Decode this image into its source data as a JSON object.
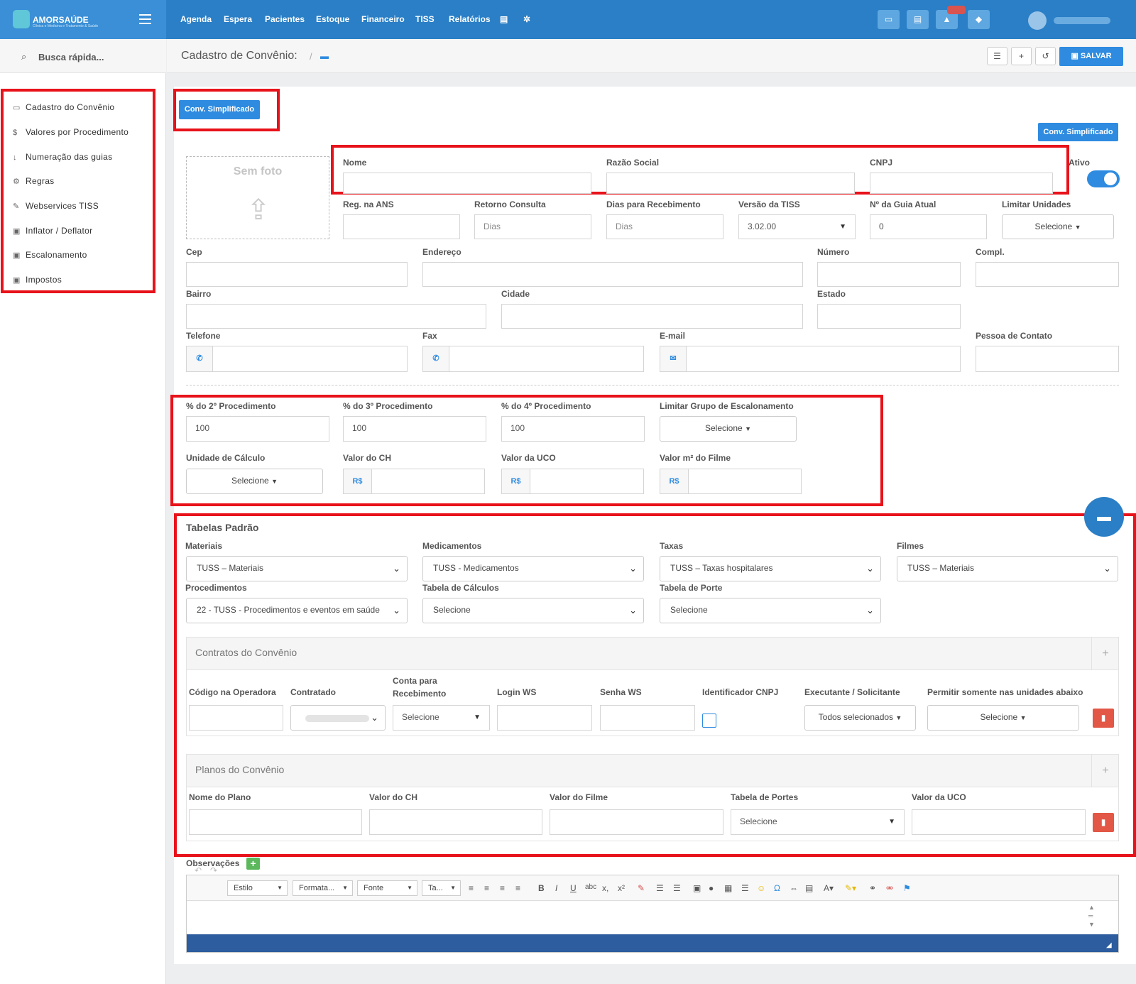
{
  "brand": {
    "name": "AMORSAÚDE",
    "tagline": "Clínica e Medicina e Tratamento & Saúde"
  },
  "nav": [
    "Agenda",
    "Espera",
    "Pacientes",
    "Estoque",
    "Financeiro",
    "TISS",
    "Relatórios"
  ],
  "search": {
    "label": "Busca rápida..."
  },
  "sidebar": [
    {
      "label": "Cadastro do Convênio",
      "icon": "card-icon"
    },
    {
      "label": "Valores por Procedimento",
      "icon": "dollar-icon"
    },
    {
      "label": "Numeração das guias",
      "icon": "sort-icon"
    },
    {
      "label": "Regras",
      "icon": "gears-icon"
    },
    {
      "label": "Webservices TISS",
      "icon": "plug-icon"
    },
    {
      "label": "Inflator / Deflator",
      "icon": "money-icon"
    },
    {
      "label": "Escalonamento",
      "icon": "money-icon"
    },
    {
      "label": "Impostos",
      "icon": "money-icon"
    }
  ],
  "header": {
    "title": "Cadastro de Convênio:",
    "sep": "/",
    "save": "SALVAR"
  },
  "conv_simplificado": "Conv. Simplificado",
  "photo": {
    "label": "Sem foto"
  },
  "fields": {
    "nome": "Nome",
    "razao": "Razão Social",
    "cnpj": "CNPJ",
    "ativo": "Ativo",
    "reg_ans": "Reg. na ANS",
    "retorno": "Retorno Consulta",
    "retorno_ph": "Dias",
    "dias_receb": "Dias para Recebimento",
    "dias_receb_ph": "Dias",
    "versao_tiss": "Versão da TISS",
    "versao_tiss_val": "3.02.00",
    "guia_atual": "Nº da Guia Atual",
    "guia_atual_val": "0",
    "limitar_unidades": "Limitar Unidades",
    "selecione": "Selecione",
    "cep": "Cep",
    "endereco": "Endereço",
    "numero": "Número",
    "compl": "Compl.",
    "bairro": "Bairro",
    "cidade": "Cidade",
    "estado": "Estado",
    "telefone": "Telefone",
    "fax": "Fax",
    "email": "E-mail",
    "pessoa_contato": "Pessoa de Contato"
  },
  "escalonamento": {
    "p2": "% do 2º Procedimento",
    "p2_val": "100",
    "p3": "% do 3º Procedimento",
    "p3_val": "100",
    "p4": "% do 4º Procedimento",
    "p4_val": "100",
    "grupo": "Limitar Grupo de Escalonamento",
    "unidade": "Unidade de Cálculo",
    "valor_ch": "Valor do CH",
    "valor_uco": "Valor da UCO",
    "valor_filme": "Valor m² do Filme",
    "currency": "R$"
  },
  "tabelas": {
    "title": "Tabelas Padrão",
    "materiais": "Materiais",
    "materiais_val": "TUSS – Materiais",
    "medicamentos": "Medicamentos",
    "medicamentos_val": "TUSS - Medicamentos",
    "taxas": "Taxas",
    "taxas_val": "TUSS – Taxas hospitalares",
    "filmes": "Filmes",
    "filmes_val": "TUSS – Materiais",
    "procedimentos": "Procedimentos",
    "procedimentos_val": "22 - TUSS - Procedimentos e eventos em saúde",
    "calculos": "Tabela de Cálculos",
    "calculos_val": "Selecione",
    "porte": "Tabela de Porte",
    "porte_val": "Selecione"
  },
  "contratos": {
    "title": "Contratos do Convênio",
    "cols": [
      "Código na Operadora",
      "Contratado",
      "Conta para Recebimento",
      "Login WS",
      "Senha WS",
      "Identificador CNPJ",
      "Executante / Solicitante",
      "Permitir somente nas unidades abaixo"
    ],
    "conta_val": "Selecione",
    "exec_val": "Todos selecionados",
    "perm_val": "Selecione"
  },
  "planos": {
    "title": "Planos do Convênio",
    "cols": [
      "Nome do Plano",
      "Valor do CH",
      "Valor do Filme",
      "Tabela de Portes",
      "Valor da UCO"
    ],
    "portes_val": "Selecione"
  },
  "obs": {
    "label": "Observações",
    "estilo": "Estilo",
    "formatacao": "Formata...",
    "fonte": "Fonte",
    "tamanho": "Ta..."
  },
  "colors": {
    "primary": "#2a7fc6",
    "accent": "#2e8be0",
    "highlight": "#e8121a",
    "danger": "#e25746"
  }
}
